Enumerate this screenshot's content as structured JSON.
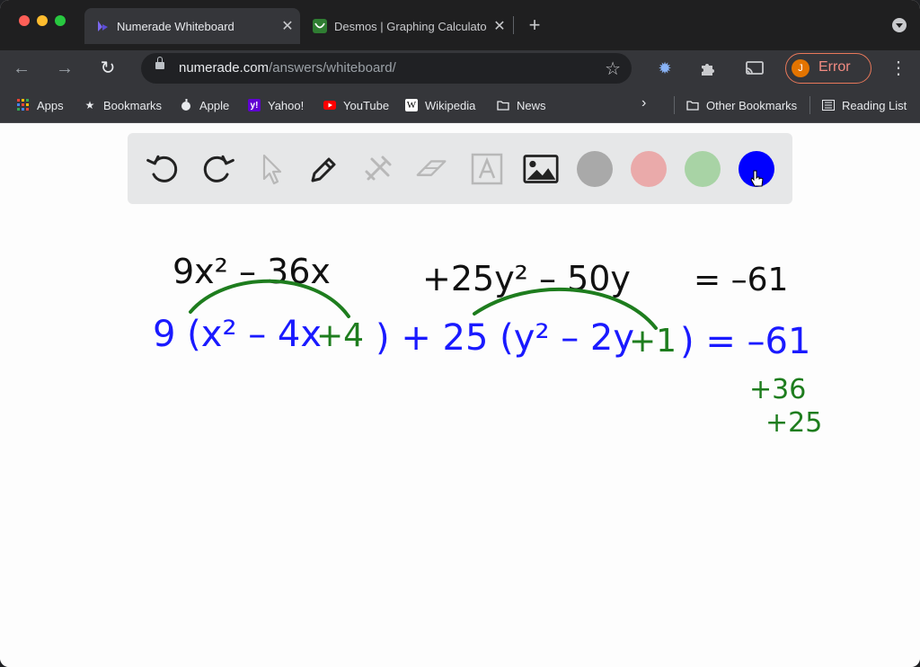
{
  "browser": {
    "tabs": [
      {
        "title": "Numerade Whiteboard",
        "active": true
      },
      {
        "title": "Desmos | Graphing Calculato",
        "active": false
      }
    ],
    "url_domain": "numerade.com",
    "url_path": "/answers/whiteboard/",
    "profile_initial": "J",
    "profile_status": "Error",
    "bookmarks": [
      "Apps",
      "Bookmarks",
      "Apple",
      "Yahoo!",
      "YouTube",
      "Wikipedia",
      "News"
    ],
    "other_bookmarks": "Other Bookmarks",
    "reading_list": "Reading List"
  },
  "whiteboard": {
    "tools": [
      "undo-icon",
      "redo-icon",
      "pointer-icon",
      "pen-icon",
      "tools-icon",
      "eraser-icon",
      "text-icon",
      "image-icon"
    ],
    "colors": [
      "#a9a9a9",
      "#eaaaaa",
      "#a8d3a5",
      "#0000ff"
    ],
    "selected_color": "#0000ff",
    "ink": {
      "line1_left": "9x² – 36x",
      "line1_mid": "+25y² – 50y",
      "line1_right": "= –61",
      "line2_a": "9 (x² – 4x",
      "line2_b": "+4",
      "line2_c": ") + 25 (y² – 2y",
      "line2_d": "+1",
      "line2_e": ") = –61",
      "note_1": "+36",
      "note_2": "+25"
    },
    "ink_colors": {
      "black": "#111111",
      "blue": "#1a1aff",
      "green": "#1e7d1e"
    }
  }
}
